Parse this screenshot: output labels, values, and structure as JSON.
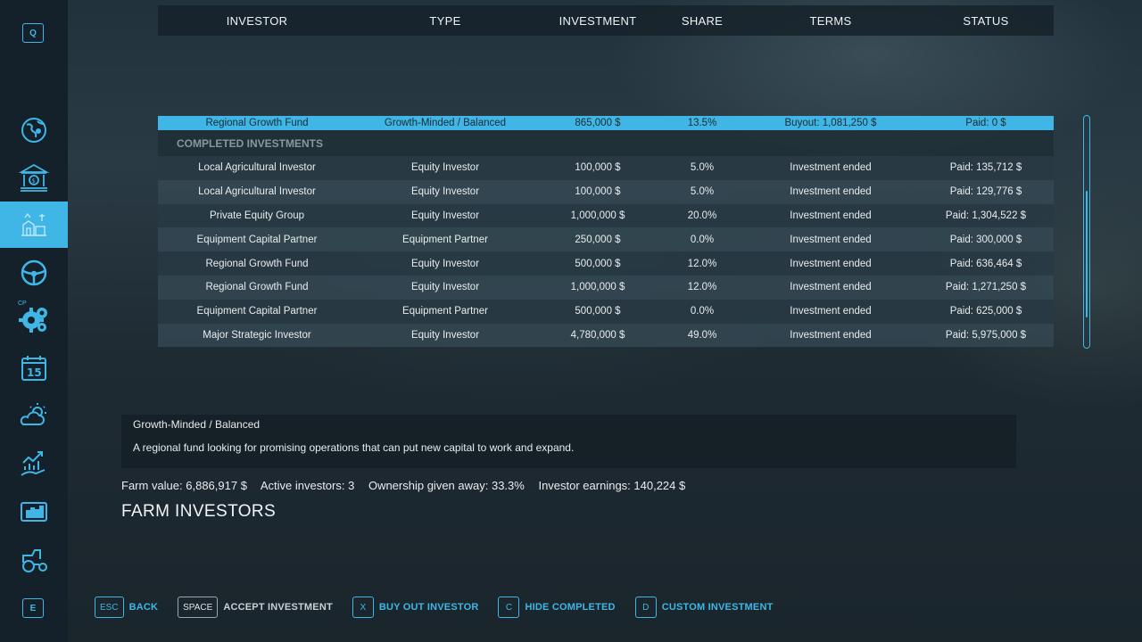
{
  "sidebar": {
    "top_key": "Q",
    "bottom_key": "E",
    "cp_label": "CP",
    "items": [
      {
        "icon": "globe-map-icon"
      },
      {
        "icon": "bank-finance-icon"
      },
      {
        "icon": "farm-investors-icon",
        "active": true
      },
      {
        "icon": "steering-wheel-icon"
      },
      {
        "icon": "gear-settings-icon"
      },
      {
        "icon": "calendar-icon",
        "text": "15"
      },
      {
        "icon": "weather-icon"
      },
      {
        "icon": "growth-chart-icon"
      },
      {
        "icon": "statistics-icon"
      },
      {
        "icon": "tractor-icon"
      }
    ]
  },
  "table": {
    "headers": [
      "INVESTOR",
      "TYPE",
      "INVESTMENT",
      "SHARE",
      "TERMS",
      "STATUS"
    ],
    "selected_row": [
      "Regional Growth Fund",
      "Growth-Minded / Balanced",
      "865,000 $",
      "13.5%",
      "Buyout: 1,081,250 $",
      "Paid: 0 $"
    ],
    "section_label": "COMPLETED INVESTMENTS",
    "rows": [
      [
        "Local Agricultural Investor",
        "Equity Investor",
        "100,000 $",
        "5.0%",
        "Investment ended",
        "Paid: 135,712 $"
      ],
      [
        "Local Agricultural Investor",
        "Equity Investor",
        "100,000 $",
        "5.0%",
        "Investment ended",
        "Paid: 129,776 $"
      ],
      [
        "Private Equity Group",
        "Equity Investor",
        "1,000,000 $",
        "20.0%",
        "Investment ended",
        "Paid: 1,304,522 $"
      ],
      [
        "Equipment Capital Partner",
        "Equipment Partner",
        "250,000 $",
        "0.0%",
        "Investment ended",
        "Paid: 300,000 $"
      ],
      [
        "Regional Growth Fund",
        "Equity Investor",
        "500,000 $",
        "12.0%",
        "Investment ended",
        "Paid: 636,464 $"
      ],
      [
        "Regional Growth Fund",
        "Equity Investor",
        "1,000,000 $",
        "12.0%",
        "Investment ended",
        "Paid: 1,271,250 $"
      ],
      [
        "Equipment Capital Partner",
        "Equipment Partner",
        "500,000 $",
        "0.0%",
        "Investment ended",
        "Paid: 625,000 $"
      ],
      [
        "Major Strategic Investor",
        "Equity Investor",
        "4,780,000 $",
        "49.0%",
        "Investment ended",
        "Paid: 5,975,000 $"
      ]
    ]
  },
  "description": {
    "title": "Growth-Minded / Balanced",
    "text": "A regional fund looking for promising operations that can put new capital to work and expand."
  },
  "stats": {
    "farm_value": "Farm value: 6,886,917 $",
    "active_investors": "Active investors: 3",
    "ownership": "Ownership given away: 33.3%",
    "earnings": "Investor earnings: 140,224 $"
  },
  "page_title": "FARM INVESTORS",
  "actions": [
    {
      "key": "ESC",
      "label": "BACK",
      "style": "blue"
    },
    {
      "key": "SPACE",
      "label": "ACCEPT INVESTMENT",
      "style": "grey"
    },
    {
      "key": "X",
      "label": "BUY OUT INVESTOR",
      "style": "blue"
    },
    {
      "key": "C",
      "label": "HIDE COMPLETED",
      "style": "blue"
    },
    {
      "key": "D",
      "label": "CUSTOM INVESTMENT",
      "style": "blue"
    }
  ],
  "colors": {
    "accent": "#3fb6e6",
    "sidebar_bg": "#14212b",
    "row_odd": "#283a44",
    "row_even": "#344852"
  }
}
